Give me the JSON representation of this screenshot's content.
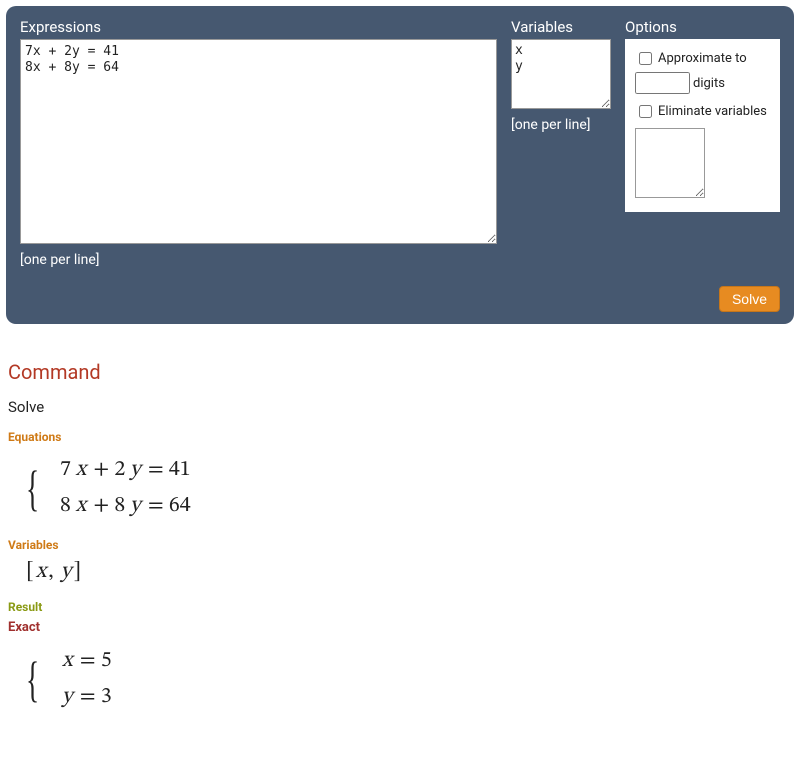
{
  "panel": {
    "expressions": {
      "label": "Expressions",
      "value": "7x + 2y = 41\n8x + 8y = 64",
      "hint": "[one per line]"
    },
    "variables": {
      "label": "Variables",
      "value": "x\ny",
      "hint": "[one per line]"
    },
    "options": {
      "label": "Options",
      "approx_label": "Approximate to",
      "digits_value": "",
      "digits_label": "digits",
      "eliminate_label": "Eliminate variables",
      "eliminate_value": ""
    },
    "solve_label": "Solve"
  },
  "output": {
    "command_heading": "Command",
    "command_value": "Solve",
    "equations_label": "Equations",
    "eq1_lhs_a": "7",
    "eq1_lhs_b": "2",
    "eq1_rhs": "41",
    "eq2_lhs_a": "8",
    "eq2_lhs_b": "8",
    "eq2_rhs": "64",
    "variables_label": "Variables",
    "variables_text": "[x, y]",
    "result_label": "Result",
    "exact_label": "Exact",
    "result_x": "5",
    "result_y": "3"
  }
}
